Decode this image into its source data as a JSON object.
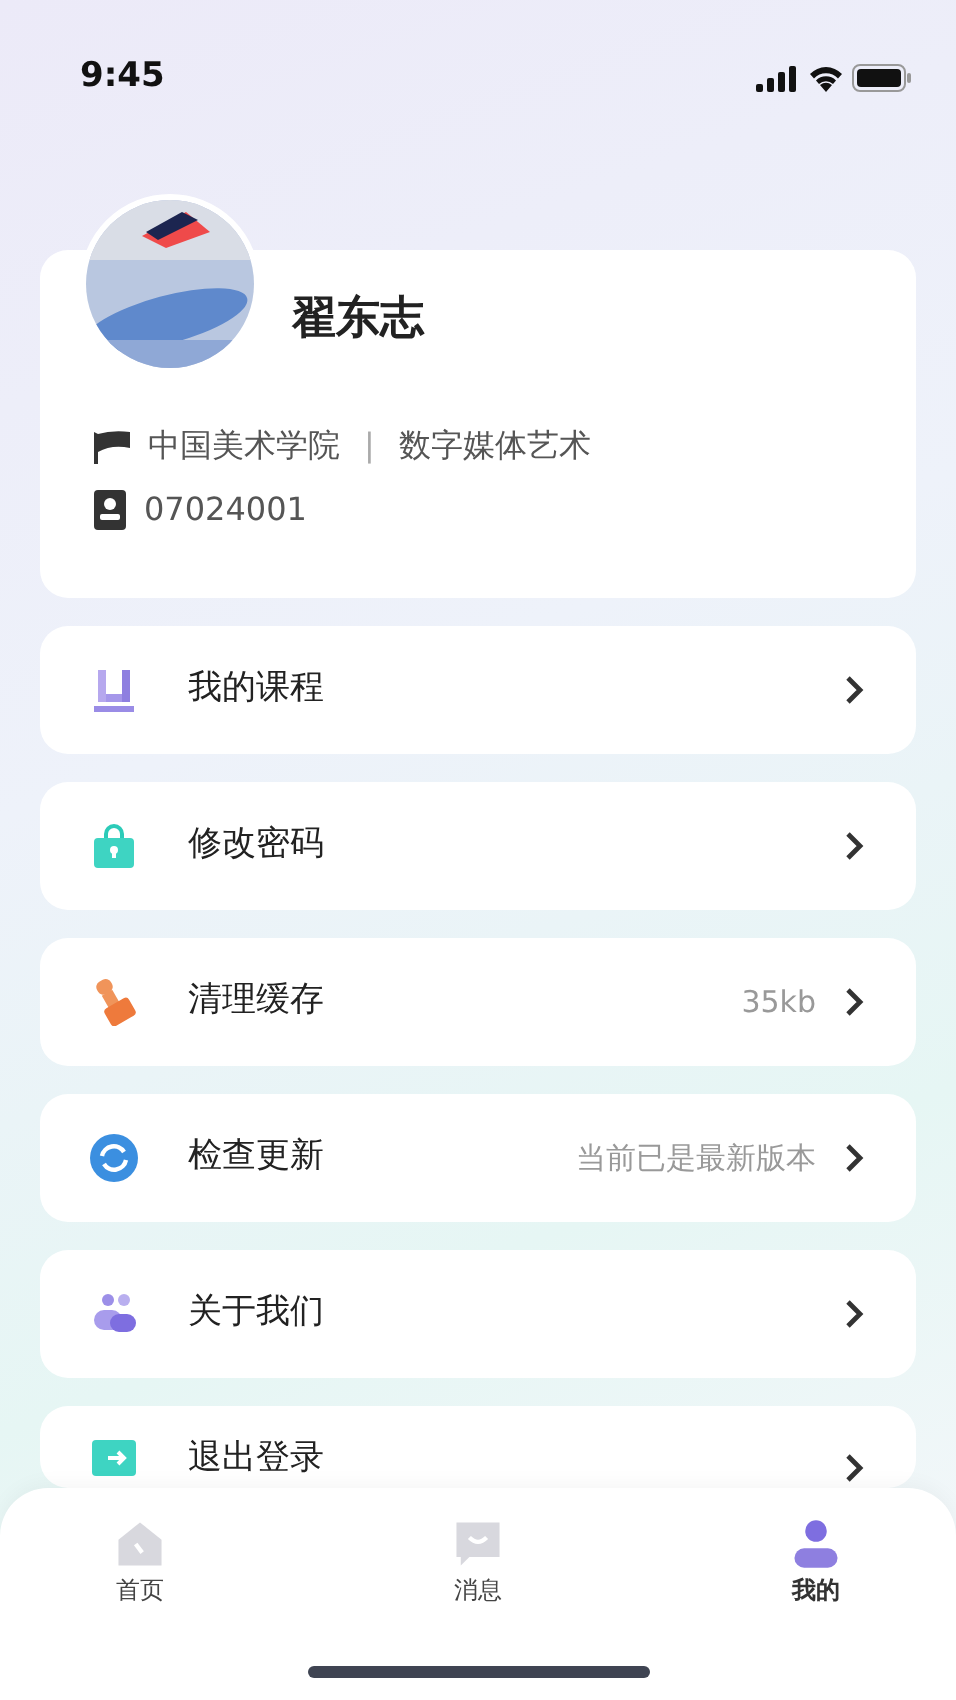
{
  "status_bar": {
    "time": "9:45"
  },
  "profile": {
    "name": "翟东志",
    "school": "中国美术学院",
    "separator": "|",
    "major": "数字媒体艺术",
    "student_id": "07024001"
  },
  "menu": [
    {
      "kind": "courses",
      "label": "我的课程"
    },
    {
      "kind": "password",
      "label": "修改密码"
    },
    {
      "kind": "cache",
      "label": "清理缓存",
      "value": "35kb"
    },
    {
      "kind": "update",
      "label": "检查更新",
      "value": "当前已是最新版本"
    },
    {
      "kind": "about",
      "label": "关于我们"
    },
    {
      "kind": "logout",
      "label": "退出登录"
    }
  ],
  "tab_bar": [
    {
      "kind": "home",
      "label": "首页",
      "selected": false
    },
    {
      "kind": "messages",
      "label": "消息",
      "selected": false
    },
    {
      "kind": "me",
      "label": "我的",
      "selected": true
    }
  ]
}
